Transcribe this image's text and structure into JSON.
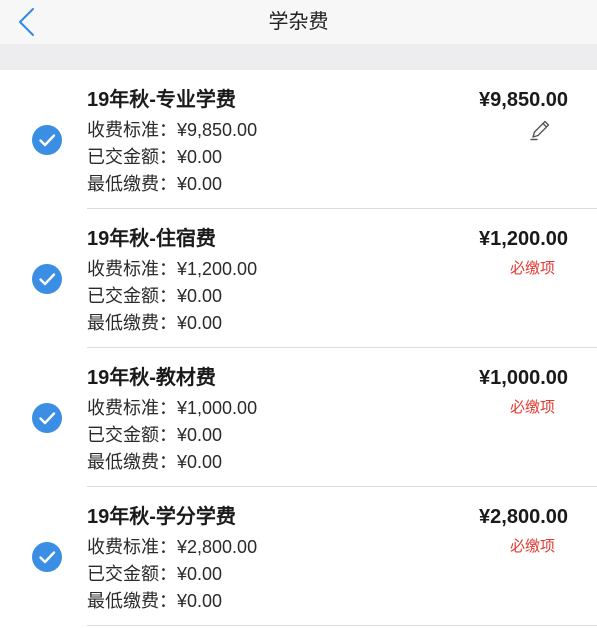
{
  "header": {
    "title": "学杂费"
  },
  "icons": {
    "back": "chevron-left-icon",
    "check": "check-circle-icon",
    "edit": "pencil-icon"
  },
  "colors": {
    "accent": "#3a8ee3",
    "required_text": "#e23a33",
    "text": "#1a1a1a",
    "separator_band": "#ededf0"
  },
  "labels": {
    "standard": "收费标准：",
    "paid": "已交金额：",
    "minimum": "最低缴费："
  },
  "badges": {
    "required": "必缴项"
  },
  "fees": [
    {
      "title": "19年秋-专业学费",
      "amount": "¥9,850.00",
      "standard": "¥9,850.00",
      "paid": "¥0.00",
      "minimum": "¥0.00",
      "checked": true,
      "required": false,
      "editable": true
    },
    {
      "title": "19年秋-住宿费",
      "amount": "¥1,200.00",
      "standard": "¥1,200.00",
      "paid": "¥0.00",
      "minimum": "¥0.00",
      "checked": true,
      "required": true,
      "editable": false
    },
    {
      "title": "19年秋-教材费",
      "amount": "¥1,000.00",
      "standard": "¥1,000.00",
      "paid": "¥0.00",
      "minimum": "¥0.00",
      "checked": true,
      "required": true,
      "editable": false
    },
    {
      "title": "19年秋-学分学费",
      "amount": "¥2,800.00",
      "standard": "¥2,800.00",
      "paid": "¥0.00",
      "minimum": "¥0.00",
      "checked": true,
      "required": true,
      "editable": false
    }
  ]
}
